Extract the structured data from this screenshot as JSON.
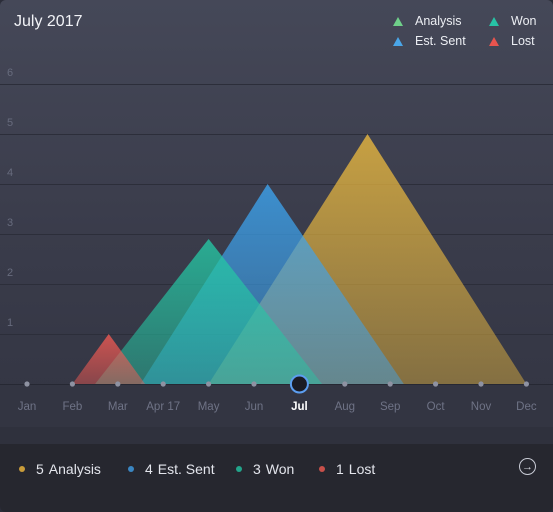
{
  "header": {
    "title": "July 2017"
  },
  "legend": [
    {
      "label": "Analysis",
      "color": "#6fd08a"
    },
    {
      "label": "Won",
      "color": "#27c3a6"
    },
    {
      "label": "Est. Sent",
      "color": "#4aa6e8"
    },
    {
      "label": "Lost",
      "color": "#e8544e"
    }
  ],
  "chart_data": {
    "type": "area",
    "title": "July 2017",
    "categories": [
      "Jan",
      "Feb",
      "Mar",
      "Apr 17",
      "May",
      "Jun",
      "Jul",
      "Aug",
      "Sep",
      "Oct",
      "Nov",
      "Dec"
    ],
    "selected_category": "Jul",
    "ylim": [
      0,
      6
    ],
    "yticks": [
      1,
      2,
      3,
      4,
      5,
      6
    ],
    "grid": true,
    "series": [
      {
        "name": "Analysis",
        "color": "#e9b83f",
        "peak_x": 7.5,
        "peak_y": 5,
        "start_x": 4,
        "end_x": 11
      },
      {
        "name": "Est. Sent",
        "color": "#3da3ee",
        "peak_x": 5.3,
        "peak_y": 4,
        "start_x": 2.5,
        "end_x": 8.3
      },
      {
        "name": "Won",
        "color": "#25c7a4",
        "peak_x": 4,
        "peak_y": 2.9,
        "start_x": 1.5,
        "end_x": 6.5
      },
      {
        "name": "Lost",
        "color": "#f25a53",
        "peak_x": 1.8,
        "peak_y": 1,
        "start_x": 1,
        "end_x": 2.6
      }
    ]
  },
  "summary": [
    {
      "count": "5",
      "label": "Analysis",
      "color": "#c99c3a"
    },
    {
      "count": "4",
      "label": "Est. Sent",
      "color": "#3a86c2"
    },
    {
      "count": "3",
      "label": "Won",
      "color": "#22a58b"
    },
    {
      "count": "1",
      "label": "Lost",
      "color": "#c8504a"
    }
  ],
  "icons": {
    "next": "arrow-right-circle-icon"
  }
}
